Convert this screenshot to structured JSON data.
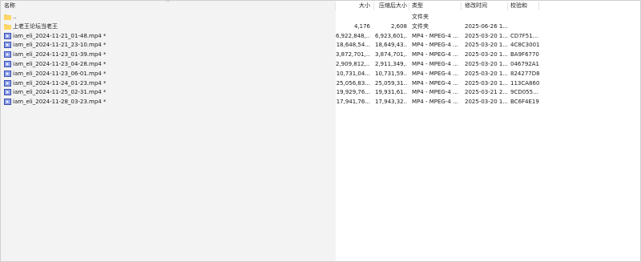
{
  "header": {
    "name": "名称",
    "size": "大小",
    "packed": "压缩后大小",
    "type": "类型",
    "modified": "修改时间",
    "crc": "校验和"
  },
  "rows": [
    {
      "name": "..",
      "size": "",
      "packed": "",
      "type": "文件夹",
      "modified": "",
      "crc": "",
      "icon": "folder-icon"
    },
    {
      "name": "上老王论坛当老王",
      "size": "4,176",
      "packed": "2,608",
      "type": "文件夹",
      "modified": "2025-06-26 1...",
      "crc": "",
      "icon": "folder-icon"
    },
    {
      "name": "iam_eli_2024-11-21_01-48.mp4 *",
      "size": "6,922,848,...",
      "packed": "6,923,601,...",
      "type": "MP4 - MPEG-4 ...",
      "modified": "2025-03-20 1...",
      "crc": "CD7F51...",
      "icon": "video-file-icon"
    },
    {
      "name": "iam_eli_2024-11-21_23-10.mp4 *",
      "size": "18,648,54...",
      "packed": "18,649,43...",
      "type": "MP4 - MPEG-4 ...",
      "modified": "2025-03-20 1...",
      "crc": "4C8C3001",
      "icon": "video-file-icon"
    },
    {
      "name": "iam_eli_2024-11-23_01-39.mp4 *",
      "size": "3,872,701,...",
      "packed": "3,874,701,...",
      "type": "MP4 - MPEG-4 ...",
      "modified": "2025-03-20 1...",
      "crc": "BA9F6770",
      "icon": "video-file-icon"
    },
    {
      "name": "iam_eli_2024-11-23_04-28.mp4 *",
      "size": "2,909,812,...",
      "packed": "2,911,349,...",
      "type": "MP4 - MPEG-4 ...",
      "modified": "2025-03-20 1...",
      "crc": "046792A1",
      "icon": "video-file-icon"
    },
    {
      "name": "iam_eli_2024-11-23_06-01.mp4 *",
      "size": "10,731,04...",
      "packed": "10,731,59...",
      "type": "MP4 - MPEG-4 ...",
      "modified": "2025-03-20 1...",
      "crc": "824277D8",
      "icon": "video-file-icon"
    },
    {
      "name": "iam_eli_2024-11-24_01-23.mp4 *",
      "size": "25,056,83...",
      "packed": "25,059,31...",
      "type": "MP4 - MPEG-4 ...",
      "modified": "2025-03-20 1...",
      "crc": "113CA860",
      "icon": "video-file-icon"
    },
    {
      "name": "iam_eli_2024-11-25_02-31.mp4 *",
      "size": "19,929,76...",
      "packed": "19,931,61...",
      "type": "MP4 - MPEG-4 ...",
      "modified": "2025-03-21 2...",
      "crc": "9CD055...",
      "icon": "video-file-icon"
    },
    {
      "name": "iam_eli_2024-11-28_03-23.mp4 *",
      "size": "17,941,76...",
      "packed": "17,943,32...",
      "type": "MP4 - MPEG-4 ...",
      "modified": "2025-03-20 1...",
      "crc": "BC6F4E19",
      "icon": "video-file-icon"
    }
  ],
  "colors": {
    "pane_left": "#f3f3f3",
    "pane_right": "#ffffff",
    "folder": "#f4c94e",
    "video": "#3a4fb0"
  }
}
